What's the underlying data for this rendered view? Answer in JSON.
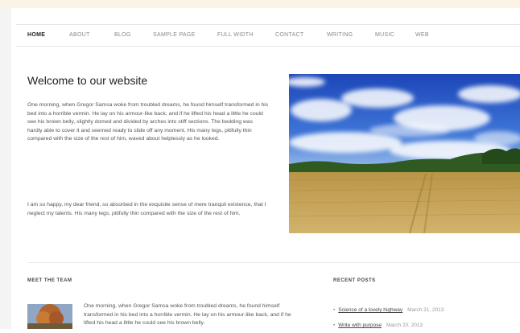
{
  "nav": {
    "items": [
      "HOME",
      "ABOUT",
      "BLOG",
      "SAMPLE PAGE",
      "FULL WIDTH",
      "CONTACT",
      "WRITING",
      "MUSIC",
      "WEB"
    ]
  },
  "main": {
    "title": "Welcome to our website",
    "paragraph1": "One morning, when Gregor Samsa woke from troubled dreams, he found himself transformed in his bed into a horrible vermin. He lay on his armour-like back, and if he lifted his head a little he could see his brown belly, slightly domed and divided by arches into stiff sections. The bedding was hardly able to cover it and seemed ready to slide off any moment. His many legs, pitifully thin compared with the size of the rest of him, waved about helplessly as he looked.",
    "paragraph2": "I am so happy, my dear friend, so absorbed in the exquisite sense of mere tranquil existence, that I neglect my talents. His many legs, pitifully thin compared with the size of the rest of him."
  },
  "widgets": {
    "team_title": "MEET THE TEAM",
    "team_text": "One morning, when Gregor Samsa woke from troubled dreams, he found himself transformed in his bed into a horrible vermin. He lay on his armour-like back, and if he lifted his head a little he could see his brown belly.",
    "recent_title": "RECENT POSTS",
    "recent_posts": [
      {
        "title": "Science of a lovely highway",
        "date": "March 21, 2013"
      },
      {
        "title": "Write with purpose",
        "date": "March 20, 2013"
      }
    ]
  },
  "colors": {
    "topbar": "#fbf3e6",
    "text": "#333333",
    "sky": "#2b5fd0",
    "field": "#c6a65a"
  }
}
